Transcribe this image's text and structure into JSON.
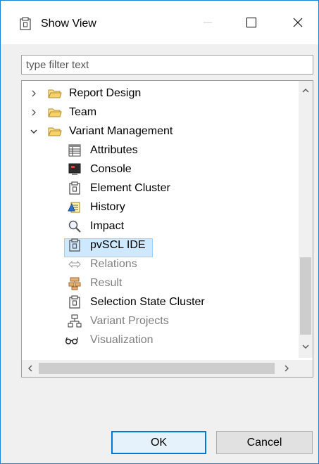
{
  "window": {
    "title": "Show View",
    "title_icon": "view-icon",
    "controls": {
      "minimize_icon": "minimize-icon",
      "maximize_icon": "maximize-icon",
      "close_icon": "close-icon"
    }
  },
  "filter": {
    "placeholder": "type filter text",
    "value": ""
  },
  "tree": {
    "items": [
      {
        "label": "Report Design",
        "icon": "folder-icon",
        "expanded": false,
        "level": 0
      },
      {
        "label": "Team",
        "icon": "folder-icon",
        "expanded": false,
        "level": 0
      },
      {
        "label": "Variant Management",
        "icon": "folder-open-icon",
        "expanded": true,
        "level": 0
      },
      {
        "label": "Attributes",
        "icon": "table-icon",
        "level": 1,
        "enabled": true
      },
      {
        "label": "Console",
        "icon": "console-icon",
        "level": 1,
        "enabled": true
      },
      {
        "label": "Element Cluster",
        "icon": "view-icon",
        "level": 1,
        "enabled": true
      },
      {
        "label": "History",
        "icon": "history-icon",
        "level": 1,
        "enabled": true
      },
      {
        "label": "Impact",
        "icon": "magnifier-icon",
        "level": 1,
        "enabled": true
      },
      {
        "label": "pvSCL IDE",
        "icon": "view-icon",
        "level": 1,
        "enabled": true,
        "selected": true
      },
      {
        "label": "Relations",
        "icon": "relations-icon",
        "level": 1,
        "enabled": false
      },
      {
        "label": "Result",
        "icon": "result-icon",
        "level": 1,
        "enabled": false
      },
      {
        "label": "Selection State Cluster",
        "icon": "view-icon",
        "level": 1,
        "enabled": true
      },
      {
        "label": "Variant Projects",
        "icon": "projects-icon",
        "level": 1,
        "enabled": false
      },
      {
        "label": "Visualization",
        "icon": "glasses-icon",
        "level": 1,
        "enabled": false
      }
    ]
  },
  "buttons": {
    "ok": "OK",
    "cancel": "Cancel"
  },
  "colors": {
    "accent": "#0078d7",
    "selection": "#cde8ff",
    "folder": "#f1c24a"
  }
}
